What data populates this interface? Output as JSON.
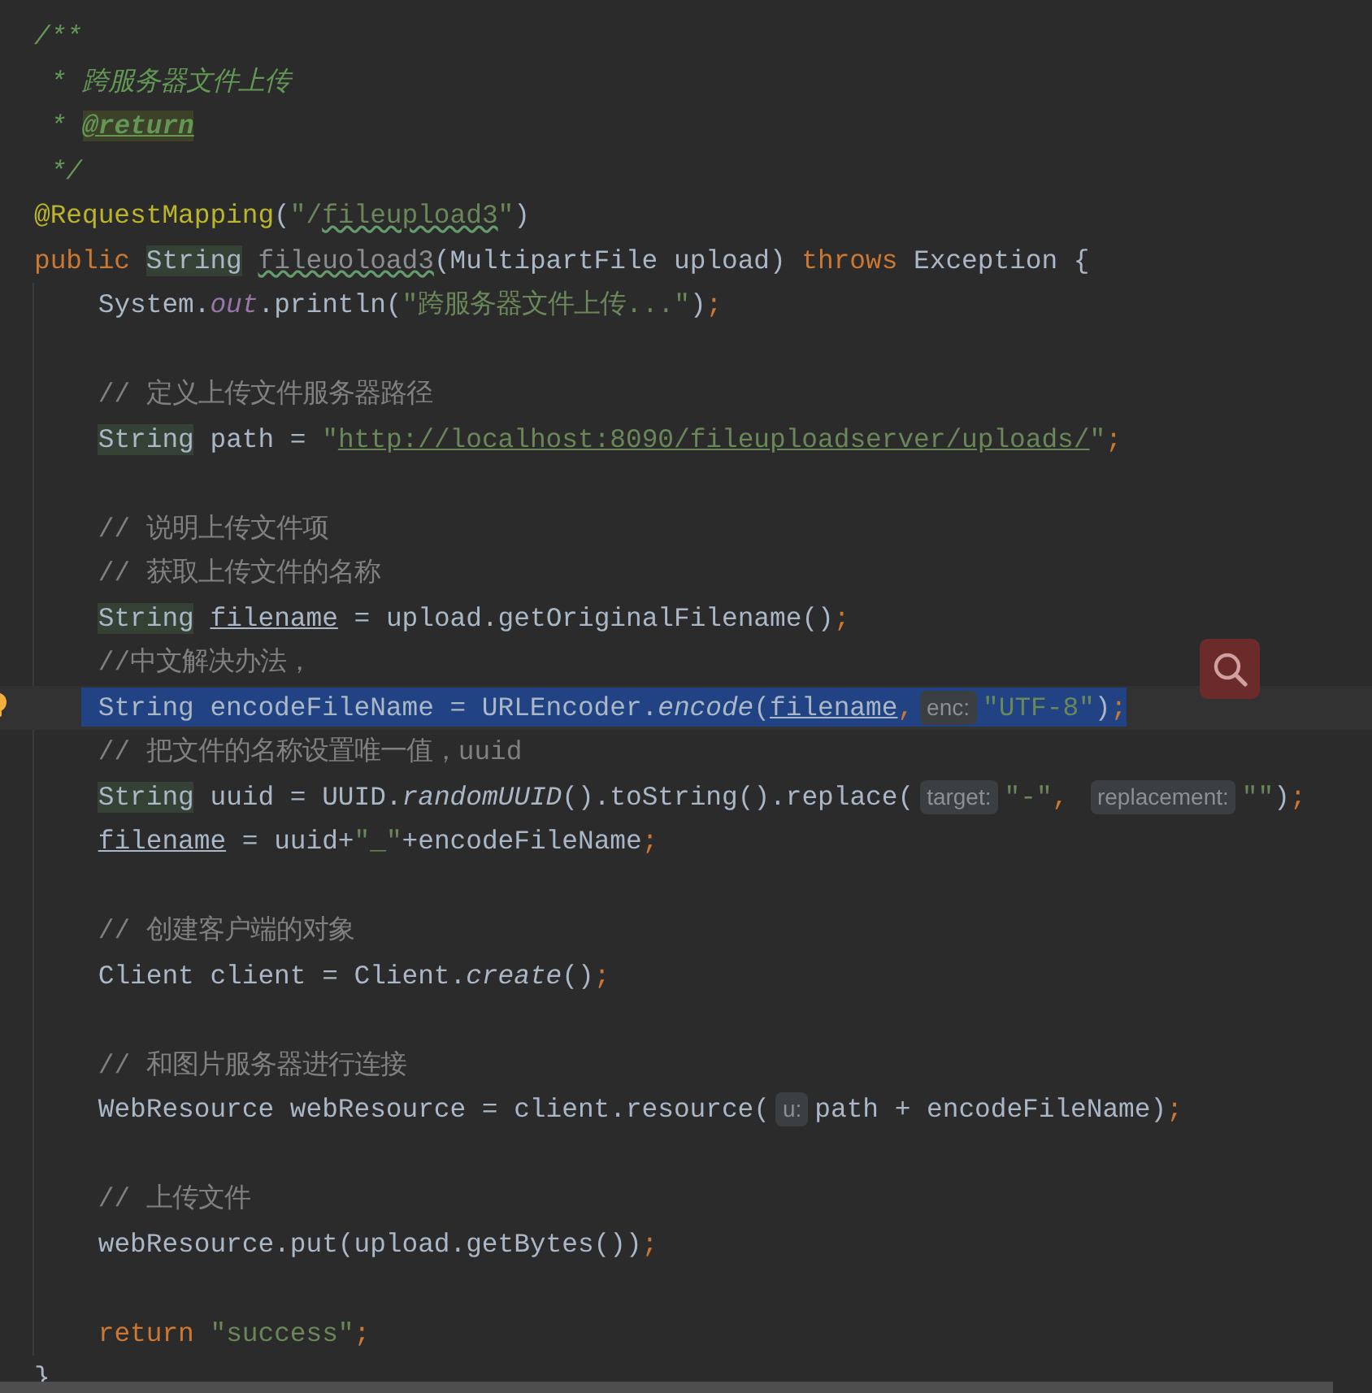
{
  "editor": {
    "lines": [
      {
        "kind": "code",
        "tokens": [
          {
            "t": "/**",
            "kind": "doc"
          }
        ]
      },
      {
        "kind": "code",
        "tokens": [
          {
            "t": " * 跨服务器文件上传",
            "kind": "doc"
          }
        ]
      },
      {
        "kind": "code",
        "tokens": [
          {
            "t": " * ",
            "kind": "doc"
          },
          {
            "t": "@return",
            "kind": "doctag"
          }
        ]
      },
      {
        "kind": "code",
        "tokens": [
          {
            "t": " */",
            "kind": "doc"
          }
        ]
      },
      {
        "kind": "code",
        "tokens": [
          {
            "t": "@RequestMapping",
            "kind": "annotation"
          },
          {
            "t": "(",
            "kind": "plain"
          },
          {
            "t": "\"/",
            "kind": "string"
          },
          {
            "t": "fileupload3",
            "kind": "typostring"
          },
          {
            "t": "\"",
            "kind": "string"
          },
          {
            "t": ")",
            "kind": "plain"
          }
        ]
      },
      {
        "kind": "code",
        "tokens": [
          {
            "t": "public ",
            "kind": "keyword"
          },
          {
            "t": "String",
            "kind": "typeusage"
          },
          {
            "t": " fileuoload3",
            "kind": "unusedtypo"
          },
          {
            "t": "(MultipartFile upload) ",
            "kind": "plain"
          },
          {
            "t": "throws",
            "kind": "keyword"
          },
          {
            "t": " Exception {",
            "kind": "plain"
          }
        ]
      },
      {
        "kind": "code",
        "tokens": [
          {
            "t": "    System.",
            "kind": "plain"
          },
          {
            "t": "out",
            "kind": "static"
          },
          {
            "t": ".println(",
            "kind": "plain"
          },
          {
            "t": "\"跨服务器文件上传...\"",
            "kind": "string"
          },
          {
            "t": ")",
            "kind": "plain"
          },
          {
            "t": ";",
            "kind": "keyword"
          }
        ]
      },
      {
        "kind": "blank"
      },
      {
        "kind": "code",
        "tokens": [
          {
            "t": "    // 定义上传文件服务器路径",
            "kind": "comment"
          }
        ]
      },
      {
        "kind": "code",
        "tokens": [
          {
            "t": "    String",
            "kind": "typeusage"
          },
          {
            "t": " path = ",
            "kind": "plain"
          },
          {
            "t": "\"",
            "kind": "string"
          },
          {
            "t": "http://localhost:8090/fileuploadserver/uploads/",
            "kind": "link"
          },
          {
            "t": "\"",
            "kind": "string"
          },
          {
            "t": ";",
            "kind": "keyword"
          }
        ]
      },
      {
        "kind": "blank"
      },
      {
        "kind": "code",
        "tokens": [
          {
            "t": "    // 说明上传文件项",
            "kind": "comment"
          }
        ]
      },
      {
        "kind": "code",
        "tokens": [
          {
            "t": "    // 获取上传文件的名称",
            "kind": "comment"
          }
        ]
      },
      {
        "kind": "code",
        "tokens": [
          {
            "t": "    String",
            "kind": "typeusage"
          },
          {
            "t": " filename",
            "kind": "varusage"
          },
          {
            "t": " = upload.getOriginalFilename()",
            "kind": "plain"
          },
          {
            "t": ";",
            "kind": "keyword"
          }
        ]
      },
      {
        "kind": "code",
        "tokens": [
          {
            "t": "    //中文解决办法，",
            "kind": "comment"
          }
        ]
      },
      {
        "kind": "code",
        "selected": true,
        "current": true,
        "bulb": true,
        "tokens": [
          {
            "t": "    String encodeFileName = URLEncoder.",
            "kind": "plain"
          },
          {
            "t": "encode",
            "kind": "italic"
          },
          {
            "t": "(",
            "kind": "plain"
          },
          {
            "t": "filename",
            "kind": "varusage"
          },
          {
            "t": ",",
            "kind": "keyword"
          },
          {
            "t": "enc:",
            "kind": "hint"
          },
          {
            "t": "\"UTF-8\"",
            "kind": "string"
          },
          {
            "t": ")",
            "kind": "plain"
          },
          {
            "t": ";",
            "kind": "keyword"
          }
        ]
      },
      {
        "kind": "code",
        "tokens": [
          {
            "t": "    // 把文件的名称设置唯一值，uuid",
            "kind": "comment"
          }
        ]
      },
      {
        "kind": "code",
        "tokens": [
          {
            "t": "    String",
            "kind": "typeusage"
          },
          {
            "t": " uuid = UUID.",
            "kind": "plain"
          },
          {
            "t": "randomUUID",
            "kind": "italic"
          },
          {
            "t": "().toString().replace(",
            "kind": "plain"
          },
          {
            "t": "target:",
            "kind": "hint"
          },
          {
            "t": "\"-\"",
            "kind": "string"
          },
          {
            "t": ",",
            "kind": "keyword"
          },
          {
            "t": " replacement:",
            "kind": "hint"
          },
          {
            "t": "\"\"",
            "kind": "string"
          },
          {
            "t": ")",
            "kind": "plain"
          },
          {
            "t": ";",
            "kind": "keyword"
          }
        ]
      },
      {
        "kind": "code",
        "tokens": [
          {
            "t": "    filename",
            "kind": "varusage"
          },
          {
            "t": " = uuid+",
            "kind": "plain"
          },
          {
            "t": "\"_\"",
            "kind": "string"
          },
          {
            "t": "+encodeFileName",
            "kind": "plain"
          },
          {
            "t": ";",
            "kind": "keyword"
          }
        ]
      },
      {
        "kind": "blank"
      },
      {
        "kind": "code",
        "tokens": [
          {
            "t": "    // 创建客户端的对象",
            "kind": "comment"
          }
        ]
      },
      {
        "kind": "code",
        "tokens": [
          {
            "t": "    Client client = Client.",
            "kind": "plain"
          },
          {
            "t": "create",
            "kind": "italic"
          },
          {
            "t": "()",
            "kind": "plain"
          },
          {
            "t": ";",
            "kind": "keyword"
          }
        ]
      },
      {
        "kind": "blank"
      },
      {
        "kind": "code",
        "tokens": [
          {
            "t": "    // 和图片服务器进行连接",
            "kind": "comment"
          }
        ]
      },
      {
        "kind": "code",
        "tokens": [
          {
            "t": "    WebResource webResource = client.resource(",
            "kind": "plain"
          },
          {
            "t": "u:",
            "kind": "hint"
          },
          {
            "t": "path + encodeFileName)",
            "kind": "plain"
          },
          {
            "t": ";",
            "kind": "keyword"
          }
        ]
      },
      {
        "kind": "blank"
      },
      {
        "kind": "code",
        "tokens": [
          {
            "t": "    // 上传文件",
            "kind": "comment"
          }
        ]
      },
      {
        "kind": "code",
        "tokens": [
          {
            "t": "    webResource.put(upload.getBytes())",
            "kind": "plain"
          },
          {
            "t": ";",
            "kind": "keyword"
          }
        ]
      },
      {
        "kind": "blank"
      },
      {
        "kind": "code",
        "tokens": [
          {
            "t": "    return",
            "kind": "keyword"
          },
          {
            "t": " \"success\"",
            "kind": "string"
          },
          {
            "t": ";",
            "kind": "keyword"
          }
        ]
      },
      {
        "kind": "code",
        "tokens": [
          {
            "t": "}",
            "kind": "plain"
          }
        ]
      }
    ]
  }
}
